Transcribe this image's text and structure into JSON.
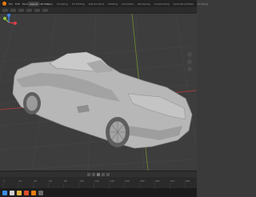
{
  "topbar": {
    "menus": [
      "File",
      "Edit",
      "Render",
      "Window",
      "Help"
    ],
    "tabs": [
      "Layout",
      "Modeling",
      "Sculpting",
      "UV Editing",
      "Texture Paint",
      "Shading",
      "Animation",
      "Rendering",
      "Compositing",
      "Geometry Nodes",
      "Scripting"
    ],
    "active_tab": "Layout"
  },
  "viewport": {
    "background": "#3d3d3d",
    "grid_color": "#474747",
    "x_axis_color": "#9c3b3b",
    "y_axis_color": "#6e8c2d",
    "model_color": "#b7b7b7",
    "model_shadow": "#8a8a8a",
    "model_dark": "#5e5e5e"
  },
  "gizmo": {
    "x_color": "#e0404a",
    "y_color": "#8cc63e",
    "z_color": "#3f86e8"
  },
  "timeline": {
    "ticks": [
      "0",
      "20",
      "40",
      "60",
      "80",
      "100",
      "120",
      "140",
      "160",
      "180",
      "200",
      "220",
      "240"
    ]
  },
  "taskbar": {
    "icons": [
      "windows-start-icon",
      "search-icon",
      "file-explorer-icon",
      "browser-icon",
      "blender-icon",
      "app-icon"
    ],
    "colors": [
      "#3a8ee6",
      "#d0d0d0",
      "#e3b341",
      "#e04d2d",
      "#e87d0d",
      "#6a6a6a"
    ]
  }
}
